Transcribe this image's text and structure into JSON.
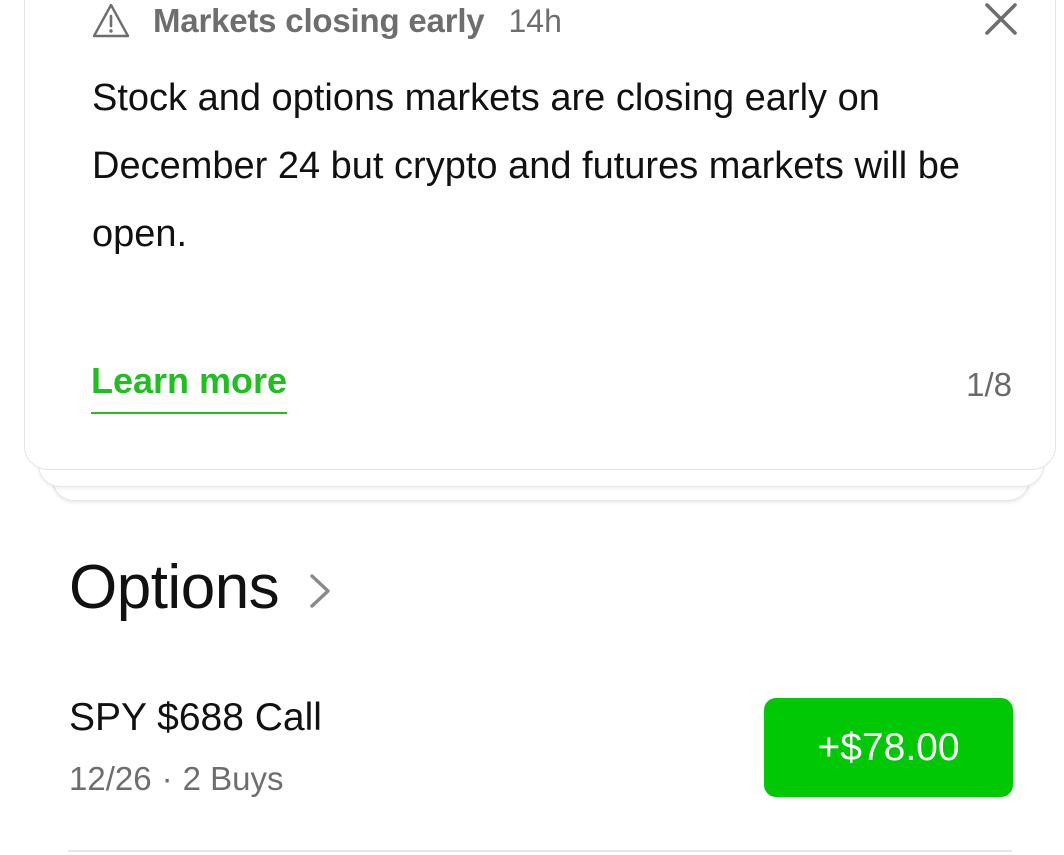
{
  "notification": {
    "title": "Markets closing early",
    "time": "14h",
    "body": "Stock and options markets are closing early on December 24 but crypto and futures markets will be open.",
    "link_label": "Learn more",
    "pager": "1/8",
    "icons": {
      "warning": "warning-triangle-icon",
      "close": "close-icon"
    },
    "link_color": "#1fbf1f"
  },
  "options_section": {
    "title": "Options",
    "chevron": "chevron-right-icon",
    "positions": [
      {
        "name": "SPY $688 Call",
        "expiry": "12/26",
        "separator": "·",
        "buys": "2 Buys",
        "pl": "+$78.00",
        "pl_color": "#00c805"
      }
    ]
  }
}
